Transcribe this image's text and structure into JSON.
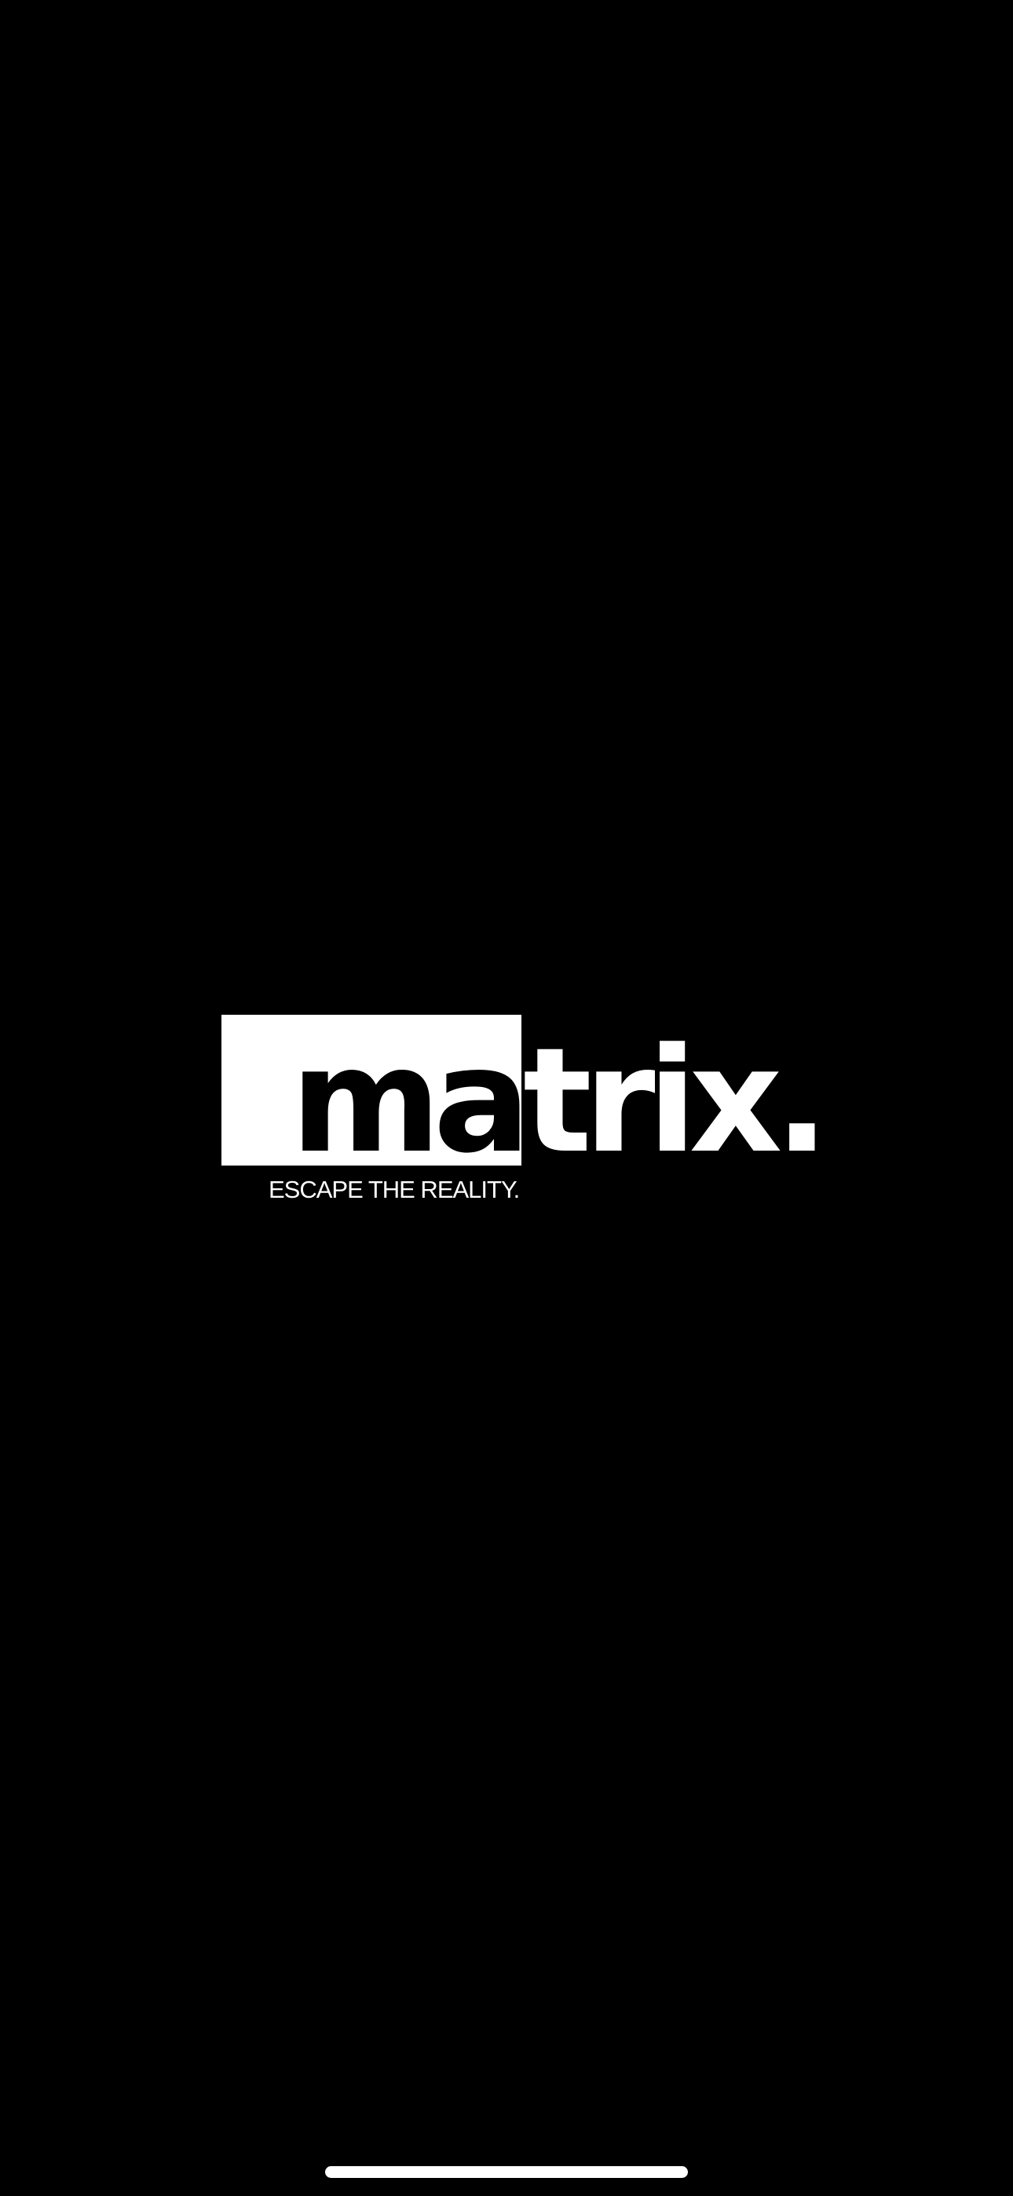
{
  "splash": {
    "logo": {
      "text_boxed": "ma",
      "text_plain": "trix."
    },
    "tagline": "ESCAPE THE REALITY."
  },
  "colors": {
    "background": "#000000",
    "foreground": "#ffffff"
  },
  "system": {
    "home_indicator": "home-indicator-bar"
  }
}
